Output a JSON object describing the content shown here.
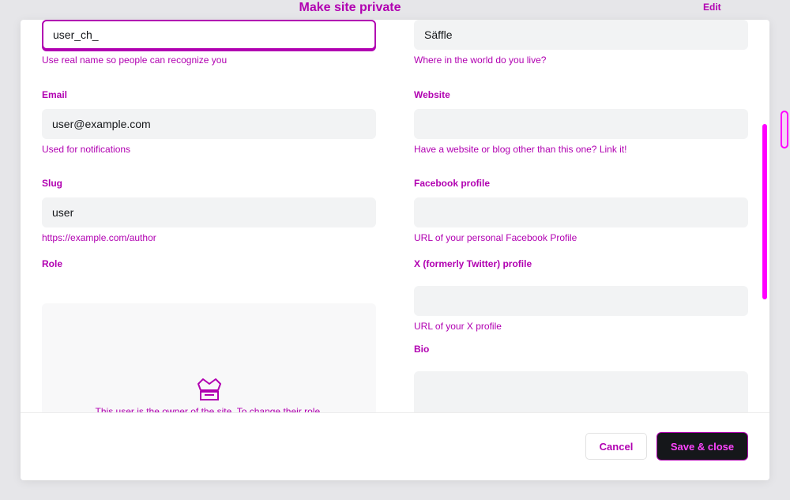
{
  "background": {
    "title": "Make site private",
    "edit_label": "Edit",
    "footer_lines": [
      "",
      ""
    ]
  },
  "left": {
    "full_name": {
      "value": "user_ch_",
      "hint": "Use real name so people can recognize you"
    },
    "email": {
      "label": "Email",
      "value": "user@example.com",
      "hint": "Used for notifications"
    },
    "slug": {
      "label": "Slug",
      "value": "user",
      "hint": "https://example.com/author"
    },
    "role": {
      "label": "Role",
      "owner_text": "This user is the owner of the site. To change their role,"
    }
  },
  "right": {
    "location": {
      "value": "Säffle",
      "hint": "Where in the world do you live?"
    },
    "website": {
      "label": "Website",
      "value": "",
      "hint": "Have a website or blog other than this one? Link it!"
    },
    "facebook": {
      "label": "Facebook profile",
      "value": "",
      "hint": "URL of your personal Facebook Profile"
    },
    "x_profile": {
      "label": "X (formerly Twitter) profile",
      "value": "",
      "hint": "URL of your X profile"
    },
    "bio": {
      "label": "Bio",
      "value": ""
    }
  },
  "footer": {
    "cancel_label": "Cancel",
    "save_label": "Save & close"
  },
  "colors": {
    "accent": "#b100b1",
    "highlight": "#ff00ff",
    "dark": "#15171a"
  },
  "icons": [
    "crown-icon"
  ]
}
